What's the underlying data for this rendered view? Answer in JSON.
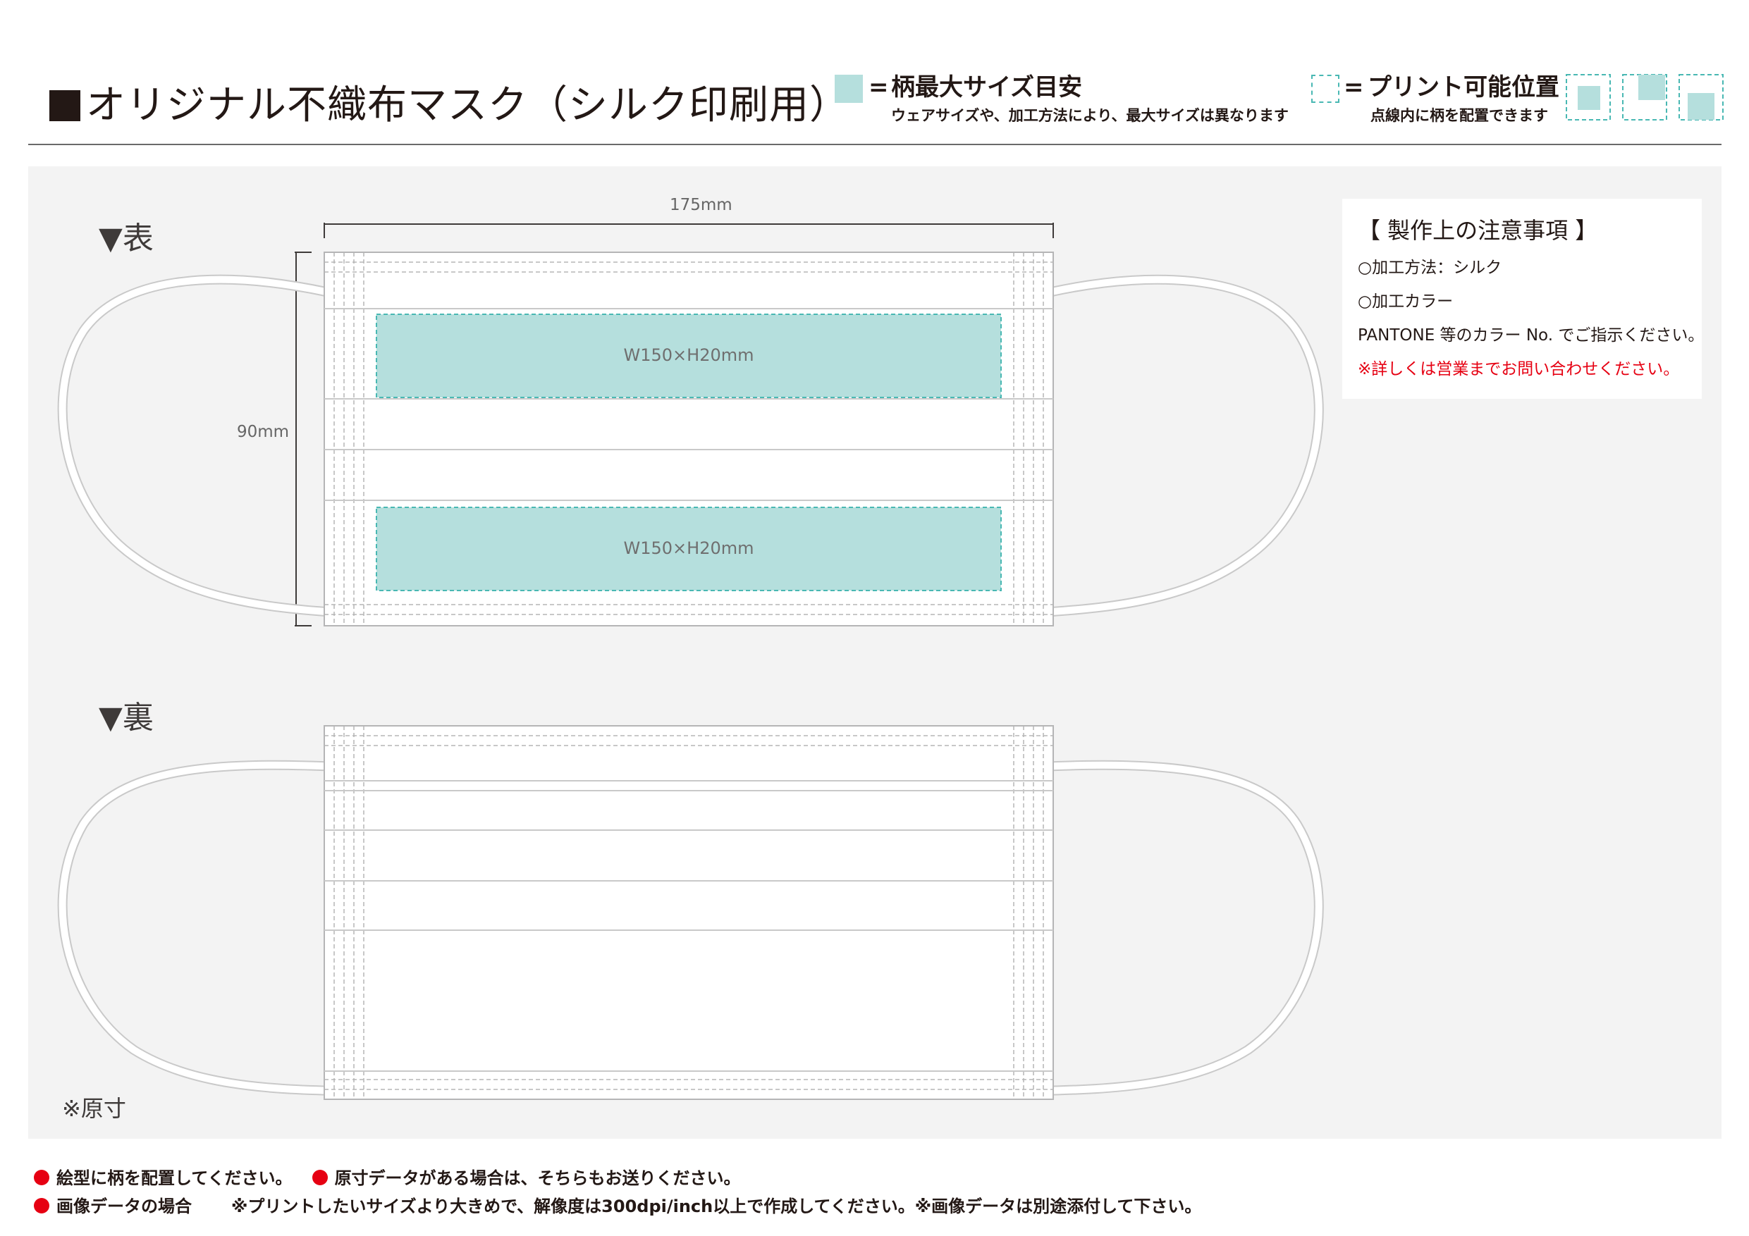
{
  "header": {
    "title": "オリジナル不織布マスク（シルク印刷用）",
    "legend_max": {
      "eq": "=",
      "title": "柄最大サイズ目安",
      "sub": "ウェアサイズや、加工方法により、最大サイズは異なります"
    },
    "legend_print": {
      "eq": "=",
      "title": "プリント可能位置",
      "sub": "点線内に柄を配置できます"
    }
  },
  "front": {
    "label": "▼表",
    "width_dim": "175mm",
    "height_dim": "90mm",
    "print_areas": [
      "W150×H20mm",
      "W150×H20mm"
    ]
  },
  "back": {
    "label": "▼裏"
  },
  "notes": {
    "title": "【 製作上の注意事項 】",
    "line1": "○加工方法：シルク",
    "line2": "○加工カラー",
    "line3": "PANTONE 等のカラー No. でご指示ください。",
    "line4": "※詳しくは営業までお問い合わせください。"
  },
  "actual_size": "※原寸",
  "footer": {
    "row1_a": "絵型に柄を配置してください。",
    "row1_b": "原寸データがある場合は、そちらもお送りください。",
    "row2_a": "画像データの場合",
    "row2_b": "※プリントしたいサイズより大きめで、解像度は300dpi/inch以上で作成してください。※画像データは別途添付して下さい。"
  },
  "colors": {
    "print_area_fill": "#b5dfdd",
    "dashed_accent": "#49b8b3",
    "bullet_red": "#e60012",
    "panel_bg": "#f3f3f3"
  }
}
